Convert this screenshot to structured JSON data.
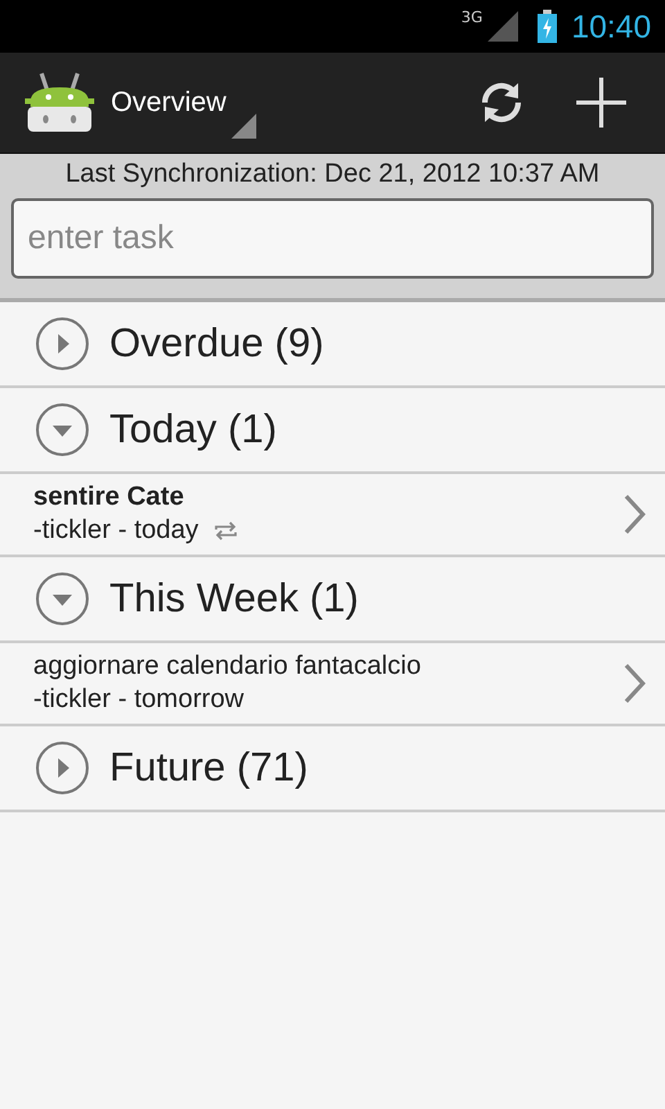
{
  "status_bar": {
    "network": "3G",
    "time": "10:40"
  },
  "action_bar": {
    "title": "Overview"
  },
  "sync": {
    "label": "Last Synchronization: Dec 21, 2012 10:37 AM"
  },
  "task_input": {
    "placeholder": "enter task"
  },
  "sections": [
    {
      "title": "Overdue (9)",
      "expanded": false
    },
    {
      "title": "Today (1)",
      "expanded": true,
      "children": [
        {
          "title": "sentire Cate",
          "subtitle": "-tickler - today",
          "highlighted": true,
          "repeating": true
        }
      ]
    },
    {
      "title": "This Week (1)",
      "expanded": true,
      "children": [
        {
          "title": "aggiornare calendario fantacalcio",
          "subtitle": "-tickler - tomorrow",
          "highlighted": false,
          "repeating": false
        }
      ]
    },
    {
      "title": "Future (71)",
      "expanded": false
    }
  ]
}
